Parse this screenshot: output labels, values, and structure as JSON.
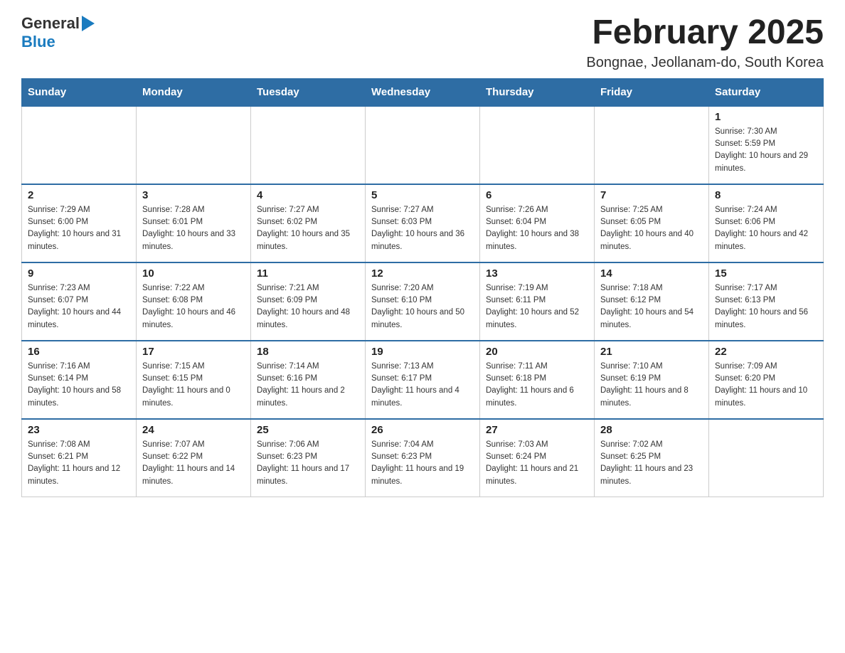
{
  "logo": {
    "general": "General",
    "blue": "Blue"
  },
  "header": {
    "title": "February 2025",
    "location": "Bongnae, Jeollanam-do, South Korea"
  },
  "days_of_week": [
    "Sunday",
    "Monday",
    "Tuesday",
    "Wednesday",
    "Thursday",
    "Friday",
    "Saturday"
  ],
  "weeks": [
    [
      {
        "day": "",
        "info": ""
      },
      {
        "day": "",
        "info": ""
      },
      {
        "day": "",
        "info": ""
      },
      {
        "day": "",
        "info": ""
      },
      {
        "day": "",
        "info": ""
      },
      {
        "day": "",
        "info": ""
      },
      {
        "day": "1",
        "info": "Sunrise: 7:30 AM\nSunset: 5:59 PM\nDaylight: 10 hours and 29 minutes."
      }
    ],
    [
      {
        "day": "2",
        "info": "Sunrise: 7:29 AM\nSunset: 6:00 PM\nDaylight: 10 hours and 31 minutes."
      },
      {
        "day": "3",
        "info": "Sunrise: 7:28 AM\nSunset: 6:01 PM\nDaylight: 10 hours and 33 minutes."
      },
      {
        "day": "4",
        "info": "Sunrise: 7:27 AM\nSunset: 6:02 PM\nDaylight: 10 hours and 35 minutes."
      },
      {
        "day": "5",
        "info": "Sunrise: 7:27 AM\nSunset: 6:03 PM\nDaylight: 10 hours and 36 minutes."
      },
      {
        "day": "6",
        "info": "Sunrise: 7:26 AM\nSunset: 6:04 PM\nDaylight: 10 hours and 38 minutes."
      },
      {
        "day": "7",
        "info": "Sunrise: 7:25 AM\nSunset: 6:05 PM\nDaylight: 10 hours and 40 minutes."
      },
      {
        "day": "8",
        "info": "Sunrise: 7:24 AM\nSunset: 6:06 PM\nDaylight: 10 hours and 42 minutes."
      }
    ],
    [
      {
        "day": "9",
        "info": "Sunrise: 7:23 AM\nSunset: 6:07 PM\nDaylight: 10 hours and 44 minutes."
      },
      {
        "day": "10",
        "info": "Sunrise: 7:22 AM\nSunset: 6:08 PM\nDaylight: 10 hours and 46 minutes."
      },
      {
        "day": "11",
        "info": "Sunrise: 7:21 AM\nSunset: 6:09 PM\nDaylight: 10 hours and 48 minutes."
      },
      {
        "day": "12",
        "info": "Sunrise: 7:20 AM\nSunset: 6:10 PM\nDaylight: 10 hours and 50 minutes."
      },
      {
        "day": "13",
        "info": "Sunrise: 7:19 AM\nSunset: 6:11 PM\nDaylight: 10 hours and 52 minutes."
      },
      {
        "day": "14",
        "info": "Sunrise: 7:18 AM\nSunset: 6:12 PM\nDaylight: 10 hours and 54 minutes."
      },
      {
        "day": "15",
        "info": "Sunrise: 7:17 AM\nSunset: 6:13 PM\nDaylight: 10 hours and 56 minutes."
      }
    ],
    [
      {
        "day": "16",
        "info": "Sunrise: 7:16 AM\nSunset: 6:14 PM\nDaylight: 10 hours and 58 minutes."
      },
      {
        "day": "17",
        "info": "Sunrise: 7:15 AM\nSunset: 6:15 PM\nDaylight: 11 hours and 0 minutes."
      },
      {
        "day": "18",
        "info": "Sunrise: 7:14 AM\nSunset: 6:16 PM\nDaylight: 11 hours and 2 minutes."
      },
      {
        "day": "19",
        "info": "Sunrise: 7:13 AM\nSunset: 6:17 PM\nDaylight: 11 hours and 4 minutes."
      },
      {
        "day": "20",
        "info": "Sunrise: 7:11 AM\nSunset: 6:18 PM\nDaylight: 11 hours and 6 minutes."
      },
      {
        "day": "21",
        "info": "Sunrise: 7:10 AM\nSunset: 6:19 PM\nDaylight: 11 hours and 8 minutes."
      },
      {
        "day": "22",
        "info": "Sunrise: 7:09 AM\nSunset: 6:20 PM\nDaylight: 11 hours and 10 minutes."
      }
    ],
    [
      {
        "day": "23",
        "info": "Sunrise: 7:08 AM\nSunset: 6:21 PM\nDaylight: 11 hours and 12 minutes."
      },
      {
        "day": "24",
        "info": "Sunrise: 7:07 AM\nSunset: 6:22 PM\nDaylight: 11 hours and 14 minutes."
      },
      {
        "day": "25",
        "info": "Sunrise: 7:06 AM\nSunset: 6:23 PM\nDaylight: 11 hours and 17 minutes."
      },
      {
        "day": "26",
        "info": "Sunrise: 7:04 AM\nSunset: 6:23 PM\nDaylight: 11 hours and 19 minutes."
      },
      {
        "day": "27",
        "info": "Sunrise: 7:03 AM\nSunset: 6:24 PM\nDaylight: 11 hours and 21 minutes."
      },
      {
        "day": "28",
        "info": "Sunrise: 7:02 AM\nSunset: 6:25 PM\nDaylight: 11 hours and 23 minutes."
      },
      {
        "day": "",
        "info": ""
      }
    ]
  ]
}
